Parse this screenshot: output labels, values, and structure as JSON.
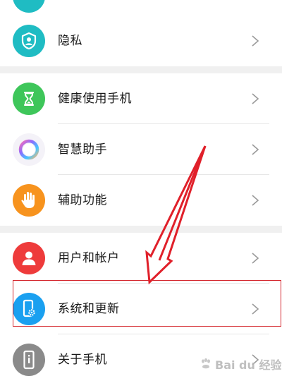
{
  "colors": {
    "background": "#f0f0f0",
    "group_background": "#ffffff",
    "privacy_icon": "#1fbcc3",
    "health_icon": "#3ec65a",
    "assistant_icon": "#f4f2f8",
    "accessibility_icon": "#f7931e",
    "users_icon": "#ee3b3b",
    "system_icon": "#1aa0f0",
    "about_icon": "#8a8a8a",
    "highlight": "#d4242b",
    "arrow": "#e0202a"
  },
  "settings": {
    "items": [
      {
        "label": "隐私",
        "icon": "privacy-shield-icon"
      },
      {
        "label": "健康使用手机",
        "icon": "hourglass-icon"
      },
      {
        "label": "智慧助手",
        "icon": "assistant-ring-icon"
      },
      {
        "label": "辅助功能",
        "icon": "hand-icon"
      },
      {
        "label": "用户和帐户",
        "icon": "user-icon"
      },
      {
        "label": "系统和更新",
        "icon": "phone-gear-icon"
      },
      {
        "label": "关于手机",
        "icon": "phone-info-icon"
      }
    ]
  },
  "watermark": {
    "text": "Bai du 经验"
  }
}
